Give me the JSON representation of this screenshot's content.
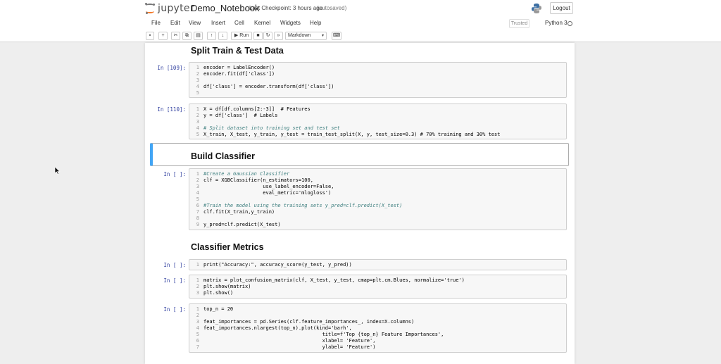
{
  "header": {
    "logo_text": "jupyter",
    "notebook_name": "Demo_Notebook",
    "checkpoint": "Last Checkpoint: 3 hours ago",
    "autosave": "(autosaved)",
    "logout_label": "Logout"
  },
  "menubar": {
    "items": [
      "File",
      "Edit",
      "View",
      "Insert",
      "Cell",
      "Kernel",
      "Widgets",
      "Help"
    ],
    "trusted": "Trusted",
    "kernel": "Python 3"
  },
  "toolbar": {
    "run_label": "Run",
    "cell_type": "Markdown"
  },
  "cells": {
    "md1": "Split Train & Test Data",
    "md2": "Build Classifier",
    "md3": "Classifier Metrics",
    "p1": "In [109]:",
    "p2": "In [110]:",
    "p3": "In [ ]:",
    "p4": "In [ ]:",
    "p5": "In [ ]:",
    "p6": "In [ ]:",
    "c1": [
      "encoder = LabelEncoder()",
      "encoder.fit(df['class'])",
      "",
      "df['class'] = encoder.transform(df['class'])",
      ""
    ],
    "c2": [
      "X = df[df.columns[2:-3]]  # Features",
      "y = df['class']  # Labels",
      "",
      "# Split dataset into training set and test set",
      "X_train, X_test, y_train, y_test = train_test_split(X, y, test_size=0.3) # 70% training and 30% test"
    ],
    "c3": [
      "#Create a Gaussian Classifier",
      "clf = XGBClassifier(n_estimators=100,",
      "                    use_label_encoder=False,",
      "                    eval_metric='mlogloss')",
      "",
      "#Train the model using the training sets y_pred=clf.predict(X_test)",
      "clf.fit(X_train,y_train)",
      "",
      "y_pred=clf.predict(X_test)"
    ],
    "c4": [
      "print(\"Accuracy:\", accuracy_score(y_test, y_pred))"
    ],
    "c5": [
      "matrix = plot_confusion_matrix(clf, X_test, y_test, cmap=plt.cm.Blues, normalize='true')",
      "plt.show(matrix)",
      "plt.show()"
    ],
    "c6": [
      "top_n = 20",
      "",
      "feat_importances = pd.Series(clf.feature_importances_, index=X.columns)",
      "feat_importances.nlargest(top_n).plot(kind='barh',",
      "                                        title=f'Top {top_n} Feature Importances',",
      "                                        xlabel= 'Feature',",
      "                                        ylabel= 'Feature')"
    ]
  }
}
